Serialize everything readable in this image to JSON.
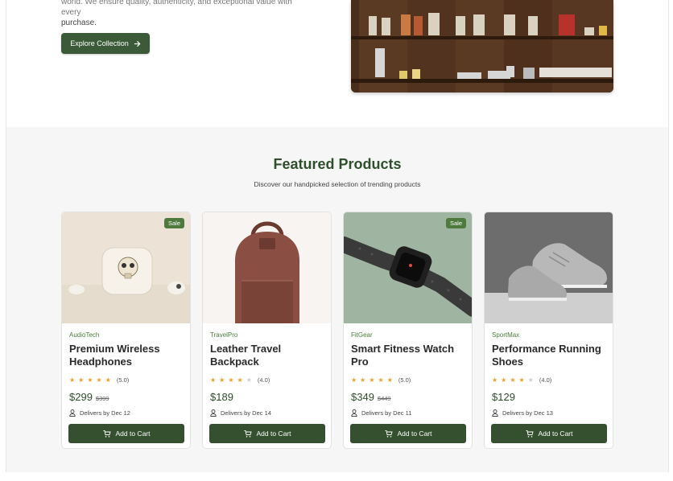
{
  "hero": {
    "text_top_clipped": "world. We ensure quality, authenticity, and exceptional value with every",
    "text_line2": "purchase.",
    "explore_label": "Explore Collection"
  },
  "featured": {
    "title": "Featured Products",
    "subtitle": "Discover our handpicked selection of trending products"
  },
  "products": [
    {
      "brand": "AudioTech",
      "name": "Premium Wireless Headphones",
      "rating": 5,
      "rating_label": "(5.0)",
      "price": "$299",
      "old_price": "$399",
      "delivery": "Delivers by Dec 12",
      "sale": "Sale",
      "cart": "Add to Cart",
      "image": "earbuds-with-skull-case"
    },
    {
      "brand": "TravelPro",
      "name": "Leather Travel Backpack",
      "rating": 4,
      "rating_label": "(4.0)",
      "price": "$189",
      "old_price": "",
      "delivery": "Delivers by Dec 14",
      "sale": "",
      "cart": "Add to Cart",
      "image": "leather-backpack"
    },
    {
      "brand": "FitGear",
      "name": "Smart Fitness Watch Pro",
      "rating": 5,
      "rating_label": "(5.0)",
      "price": "$349",
      "old_price": "$449",
      "delivery": "Delivers by Dec 11",
      "sale": "Sale",
      "cart": "Add to Cart",
      "image": "smart-watch"
    },
    {
      "brand": "SportMax",
      "name": "Performance Running Shoes",
      "rating": 4,
      "rating_label": "(4.0)",
      "price": "$129",
      "old_price": "",
      "delivery": "Delivers by Dec 13",
      "sale": "",
      "cart": "Add to Cart",
      "image": "running-shoes"
    }
  ],
  "colors": {
    "accent": "#34502f",
    "brand": "#4e7a3e",
    "star": "#e9a12a"
  }
}
